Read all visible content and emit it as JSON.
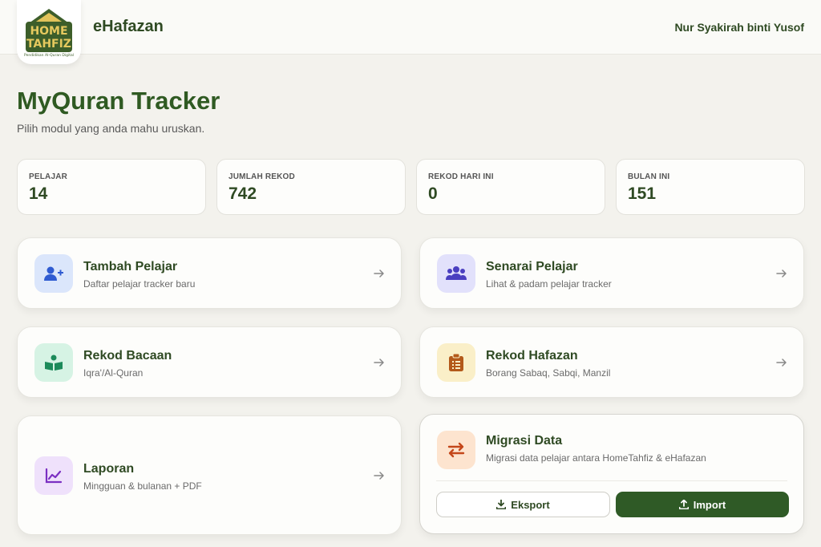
{
  "header": {
    "logo_line1": "HOME",
    "logo_line2": "TAHFIZ",
    "logo_tagline": "Pendidikan Al-Quran Digital",
    "app_name": "eHafazan",
    "user_name": "Nur Syakirah binti Yusof"
  },
  "page": {
    "title": "MyQuran Tracker",
    "subtitle": "Pilih modul yang anda mahu uruskan."
  },
  "stats": [
    {
      "label": "PELAJAR",
      "value": "14"
    },
    {
      "label": "JUMLAH REKOD",
      "value": "742"
    },
    {
      "label": "REKOD HARI INI",
      "value": "0"
    },
    {
      "label": "BULAN INI",
      "value": "151"
    }
  ],
  "modules": [
    {
      "title": "Tambah Pelajar",
      "desc": "Daftar pelajar tracker baru",
      "icon": "user-plus-icon",
      "color": "#dbe6fb"
    },
    {
      "title": "Senarai Pelajar",
      "desc": "Lihat & padam pelajar tracker",
      "icon": "users-icon",
      "color": "#e2e1fb"
    },
    {
      "title": "Rekod Bacaan",
      "desc": "Iqra'/Al-Quran",
      "icon": "book-reader-icon",
      "color": "#d6f3e4"
    },
    {
      "title": "Rekod Hafazan",
      "desc": "Borang Sabaq, Sabqi, Manzil",
      "icon": "clipboard-icon",
      "color": "#faefc8"
    },
    {
      "title": "Laporan",
      "desc": "Mingguan & bulanan + PDF",
      "icon": "chart-line-icon",
      "color": "#efe1fb"
    },
    {
      "title": "Migrasi Data",
      "desc": "Migrasi data pelajar antara HomeTahfiz & eHafazan",
      "icon": "exchange-icon",
      "color": "#fde4cf"
    }
  ],
  "migration": {
    "export_label": "Eksport",
    "import_label": "Import"
  }
}
